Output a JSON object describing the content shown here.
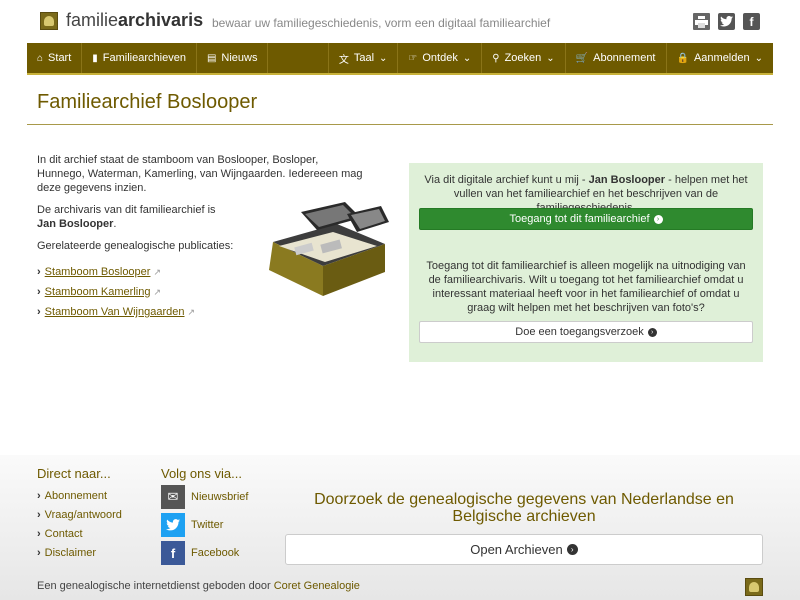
{
  "header": {
    "brand_light": "familie",
    "brand_bold": "archivaris",
    "tagline": "bewaar uw familiegeschiedenis, vorm een digitaal familiearchief"
  },
  "nav": {
    "start": "Start",
    "archives": "Familiearchieven",
    "news": "Nieuws",
    "language": "Taal",
    "discover": "Ontdek",
    "search": "Zoeken",
    "subscription": "Abonnement",
    "login": "Aanmelden"
  },
  "page": {
    "title": "Familiearchief Boslooper"
  },
  "content": {
    "intro": "In dit archief staat de stamboom van Boslooper, Bosloper, Hunnego, Waterman, Kamerling, van Wijngaarden. Iedereeen mag deze gegevens inzien.",
    "archivist_prefix": "De archivaris van dit familiearchief is ",
    "archivist_name": "Jan Boslooper",
    "archivist_suffix": ".",
    "related_label": "Gerelateerde genealogische publicaties:",
    "links": [
      "Stamboom Boslooper",
      "Stamboom Kamerling",
      "Stamboom Van Wijngaarden"
    ]
  },
  "panel": {
    "text1_prefix": "Via dit digitale archief kunt u mij - ",
    "text1_name": "Jan Boslooper",
    "text1_suffix": " - helpen met het vullen van het familiearchief en het beschrijven van de familiegeschiedenis.",
    "access_button": "Toegang tot dit familiearchief",
    "text2": "Toegang tot dit familiearchief is alleen mogelijk na uitnodiging van de familiearchivaris. Wilt u toegang tot het familiearchief omdat u interessant materiaal heeft voor in het familiearchief of omdat u graag wilt helpen met het beschrijven van foto's?",
    "request_button": "Doe een toegangsverzoek"
  },
  "footer": {
    "direct_head": "Direct naar...",
    "direct_links": [
      "Abonnement",
      "Vraag/antwoord",
      "Contact",
      "Disclaimer"
    ],
    "follow_head": "Volg ons via...",
    "newsletter": "Nieuwsbrief",
    "twitter": "Twitter",
    "facebook": "Facebook",
    "search_title": "Doorzoek de genealogische gegevens van Nederlandse en Belgische archieven",
    "open_button": "Open Archieven",
    "bottom_text": "Een genealogische internetdienst geboden door ",
    "bottom_link": "Coret Genealogie"
  },
  "colors": {
    "nav_bg": "#6e5a00",
    "accent": "#6e5a00",
    "green_button": "#2f8a2f",
    "panel_bg": "#dff0d8",
    "twitter": "#1da1f2",
    "facebook": "#3b5998"
  }
}
